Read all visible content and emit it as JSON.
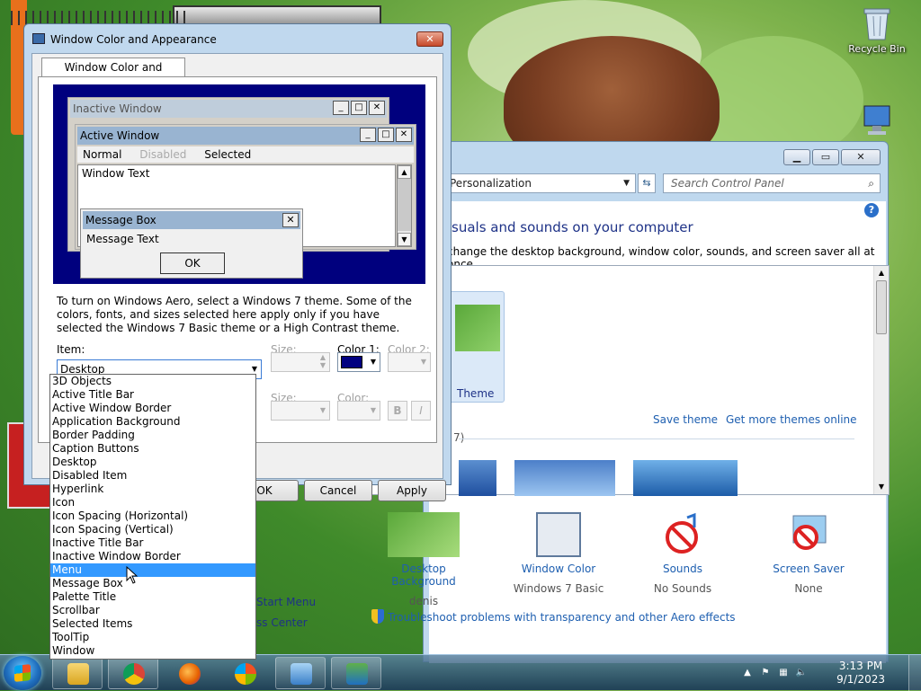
{
  "desktop": {
    "icons": [
      {
        "label": "Recycle Bin"
      },
      {
        "label": "Computer"
      }
    ]
  },
  "personalization": {
    "address": "Personalization",
    "search_placeholder": "Search Control Panel",
    "heading": "visuals and sounds on your computer",
    "subtitle": "change the desktop background, window color, sounds, and screen saver all at once.",
    "my_theme_label": "Theme",
    "save_theme": "Save theme",
    "get_more_themes": "Get more themes online",
    "theme_count": "7)",
    "bottom_items": [
      {
        "title": "Desktop Background",
        "value": "denis"
      },
      {
        "title": "Window Color",
        "value": "Windows 7 Basic"
      },
      {
        "title": "Sounds",
        "value": "No Sounds"
      },
      {
        "title": "Screen Saver",
        "value": "None"
      }
    ],
    "troubleshoot": "Troubleshoot problems with transparency and other Aero effects",
    "left_links": [
      "Start Menu",
      "ss Center"
    ],
    "help": "?"
  },
  "dialog": {
    "title": "Window Color and Appearance",
    "tab": "Window Color and Appearance",
    "preview": {
      "inactive_title": "Inactive Window",
      "active_title": "Active Window",
      "menu_normal": "Normal",
      "menu_disabled": "Disabled",
      "menu_selected": "Selected",
      "window_text": "Window Text",
      "msgbox_title": "Message Box",
      "msgbox_text": "Message Text",
      "msgbox_ok": "OK"
    },
    "info": "To turn on Windows Aero, select a Windows 7 theme.  Some of the colors, fonts, and sizes selected here apply only if you have selected the Windows 7 Basic theme or a High Contrast theme.",
    "item_label": "Item:",
    "item_value": "Desktop",
    "size_label": "Size:",
    "color1_label": "Color 1:",
    "color2_label": "Color 2:",
    "font_size_label": "Size:",
    "font_color_label": "Color:",
    "bold": "B",
    "italic": "I",
    "color1_value": "#000080",
    "buttons": {
      "ok": "OK",
      "cancel": "Cancel",
      "apply": "Apply"
    },
    "item_options": [
      "3D Objects",
      "Active Title Bar",
      "Active Window Border",
      "Application Background",
      "Border Padding",
      "Caption Buttons",
      "Desktop",
      "Disabled Item",
      "Hyperlink",
      "Icon",
      "Icon Spacing (Horizontal)",
      "Icon Spacing (Vertical)",
      "Inactive Title Bar",
      "Inactive Window Border",
      "Menu",
      "Message Box",
      "Palette Title",
      "Scrollbar",
      "Selected Items",
      "ToolTip",
      "Window"
    ],
    "highlighted_option": "Menu"
  },
  "taskbar": {
    "apps": [
      "file-explorer",
      "chrome",
      "firefox",
      "windows-media",
      "control-panel",
      "display"
    ],
    "clock_time": "3:13 PM",
    "clock_date": "9/1/2023"
  }
}
